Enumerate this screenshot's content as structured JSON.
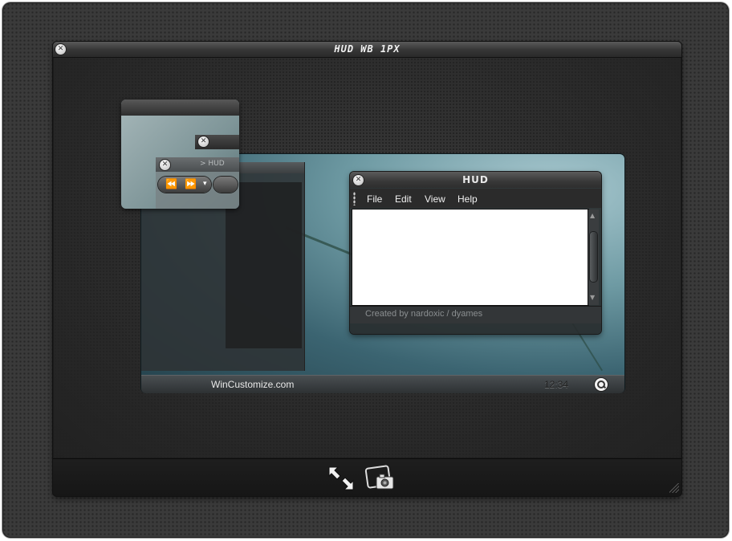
{
  "main_window": {
    "title": "HUD WB 1PX",
    "close_glyph": "✕"
  },
  "preview": {
    "mini_window": {
      "apple_glyph": "",
      "sub_window_label": "> HUD",
      "controls": [
        "⏪",
        "⏩",
        "▾"
      ]
    },
    "hud_window": {
      "title": "HUD",
      "menu": [
        "File",
        "Edit",
        "View",
        "Help"
      ],
      "status_text": "Created by nardoxic / dyames",
      "scroll_up": "▲",
      "scroll_down": "▼"
    },
    "taskbar": {
      "apple_glyph": "",
      "site": "WinCustomize.com",
      "clock": "12:34"
    }
  },
  "footer": {
    "icons": [
      "expand-arrows-icon",
      "camera-screenshot-icon"
    ]
  }
}
